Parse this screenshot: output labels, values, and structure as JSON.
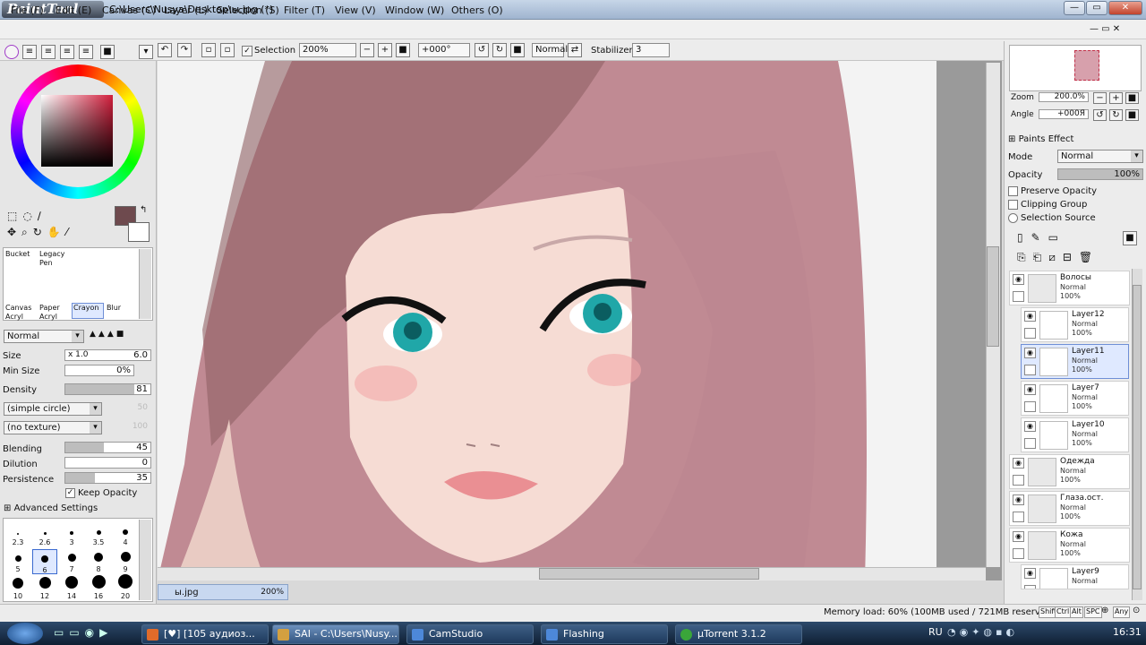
{
  "window": {
    "app_logo": "PaintTool SAI",
    "title": "C:\\Users\\Nusya\\Desktop\\ы.jpg (*)"
  },
  "menu": [
    "File (F)",
    "Edit (E)",
    "Canvas (C)",
    "Layer (L)",
    "Selection (S)",
    "Filter (T)",
    "View (V)",
    "Window (W)",
    "Others (O)"
  ],
  "toolbar": {
    "selection_label": "Selection",
    "zoom": "200%",
    "angle": "+000°",
    "blend": "Normal",
    "stabilizer_label": "Stabilizer",
    "stabilizer": "3"
  },
  "tools": {
    "brush_names": [
      "Bucket",
      "Legacy Pen",
      "Canvas Acryl",
      "Paper Acryl",
      "Crayon",
      "Blur"
    ],
    "mode": "Normal",
    "size_label": "Size",
    "size_mult": "x 1.0",
    "size": "6.0",
    "min_size_label": "Min Size",
    "min_size": "0%",
    "density_label": "Density",
    "density": "81",
    "shape": "(simple circle)",
    "shape_val": "50",
    "texture": "(no texture)",
    "texture_val": "100",
    "blending_label": "Blending",
    "blending": "45",
    "dilution_label": "Dilution",
    "dilution": "0",
    "persistence_label": "Persistence",
    "persistence": "35",
    "keep_opacity": "Keep Opacity",
    "advanced": "Advanced Settings",
    "brush_sizes": [
      "2.3",
      "2.6",
      "3",
      "3.5",
      "4",
      "5",
      "6",
      "7",
      "8",
      "9",
      "10",
      "12",
      "14",
      "16",
      "20"
    ],
    "colors": {
      "primary": "#6e4a4e",
      "accent": "#3a6ad0"
    }
  },
  "navigator": {
    "zoom_label": "Zoom",
    "zoom": "200.0%",
    "angle_label": "Angle",
    "angle": "+000Я"
  },
  "layers_panel": {
    "paints_effect": "Paints Effect",
    "mode_label": "Mode",
    "mode": "Normal",
    "opacity_label": "Opacity",
    "opacity": "100%",
    "preserve_opacity": "Preserve Opacity",
    "clipping_group": "Clipping Group",
    "selection_source": "Selection Source",
    "layers": [
      {
        "name": "Волосы",
        "mode": "Normal",
        "opacity": "100%"
      },
      {
        "name": "Layer12",
        "mode": "Normal",
        "opacity": "100%"
      },
      {
        "name": "Layer11",
        "mode": "Normal",
        "opacity": "100%"
      },
      {
        "name": "Layer7",
        "mode": "Normal",
        "opacity": "100%"
      },
      {
        "name": "Layer10",
        "mode": "Normal",
        "opacity": "100%"
      },
      {
        "name": "Одежда",
        "mode": "Normal",
        "opacity": "100%"
      },
      {
        "name": "Глаза.ост.",
        "mode": "Normal",
        "opacity": "100%"
      },
      {
        "name": "Кожа",
        "mode": "Normal",
        "opacity": "100%"
      },
      {
        "name": "Layer9",
        "mode": "Normal",
        "opacity": ""
      }
    ]
  },
  "document_tab": {
    "name": "ы.jpg",
    "zoom": "200%"
  },
  "status": {
    "memory": "Memory load: 60% (100MB used / 721MB reserved)",
    "keys": [
      "Shift",
      "Ctrl",
      "Alt",
      "SPC"
    ],
    "any": "Any"
  },
  "taskbar": {
    "items": [
      "[♥] [105 аудиоз...",
      "SAI - C:\\Users\\Nusy...",
      "CamStudio",
      "Flashing",
      "µTorrent 3.1.2"
    ],
    "lang": "RU",
    "clock": "16:31"
  }
}
